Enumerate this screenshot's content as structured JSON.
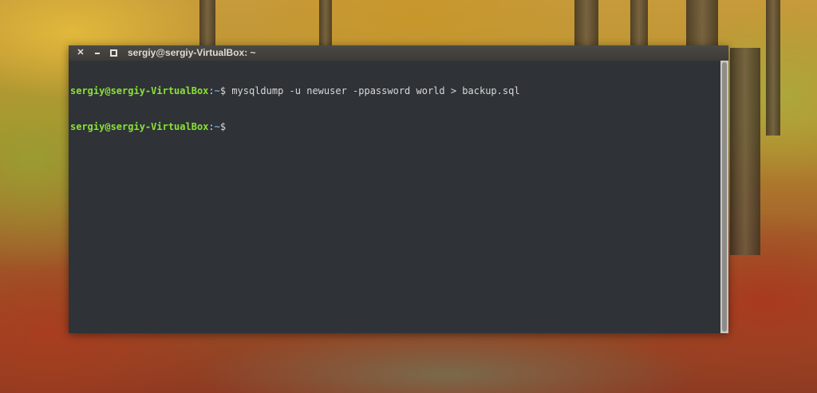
{
  "window": {
    "title": "sergiy@sergiy-VirtualBox: ~",
    "controls": {
      "close_icon": "close-icon",
      "minimize_icon": "minimize-icon",
      "maximize_icon": "maximize-icon"
    }
  },
  "terminal": {
    "lines": [
      {
        "user_host": "sergiy@sergiy-VirtualBox",
        "colon": ":",
        "path": "~",
        "symbol": "$ ",
        "command": "mysqldump -u newuser -ppassword world > backup.sql"
      },
      {
        "user_host": "sergiy@sergiy-VirtualBox",
        "colon": ":",
        "path": "~",
        "symbol": "$",
        "command": ""
      }
    ]
  },
  "colors": {
    "terminal_background": "#2f3337",
    "prompt_user": "#8ae234",
    "prompt_path": "#729fcf",
    "text": "#d8d8d8",
    "titlebar": "#3c3b37"
  }
}
